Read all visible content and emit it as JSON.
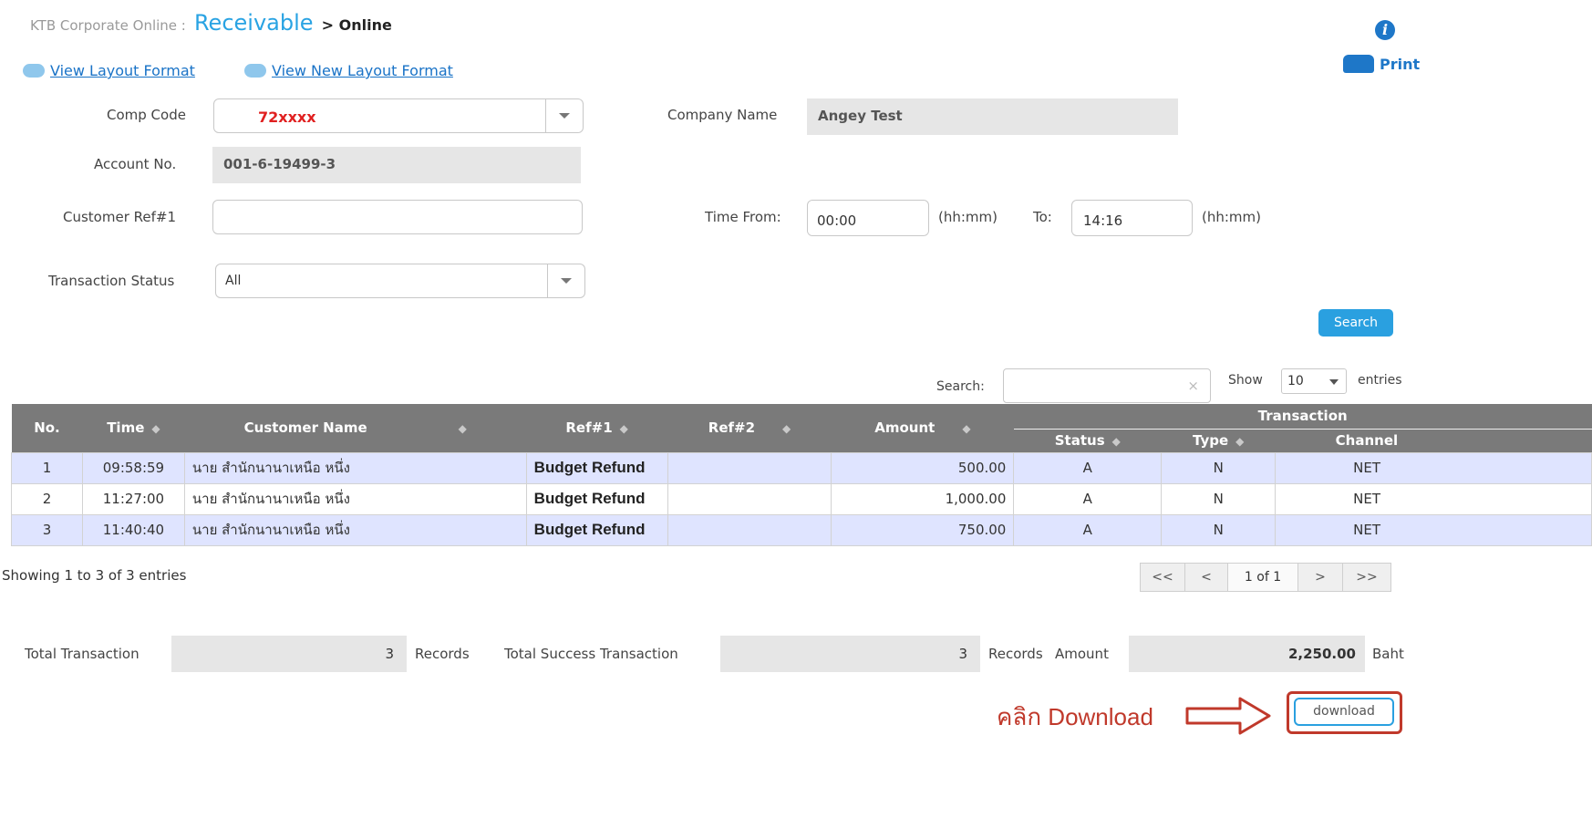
{
  "header": {
    "brand": "KTB Corporate Online :",
    "module": "Receivable",
    "crumb": "> Online"
  },
  "links": {
    "layout": "View Layout Format",
    "new_layout": "View New Layout Format",
    "print": "Print"
  },
  "form": {
    "comp_code_label": "Comp Code",
    "comp_code_value": "72xxxx",
    "company_name_label": "Company Name",
    "company_name_value": "Angey Test",
    "account_label": "Account No.",
    "account_value": "001-6-19499-3",
    "customer_ref_label": "Customer Ref#1",
    "customer_ref_value": "",
    "time_from_label": "Time From:",
    "time_from_value": "00:00",
    "time_format": "(hh:mm)",
    "to_label": "To:",
    "time_to_value": "14:16",
    "status_label": "Transaction Status",
    "status_value": "All",
    "search_button": "Search"
  },
  "table_controls": {
    "search_label": "Search:",
    "search_clear": "×",
    "show_label": "Show",
    "show_value": "10",
    "entries_label": "entries"
  },
  "table": {
    "headers": {
      "no": "No.",
      "time": "Time",
      "customer_name": "Customer Name",
      "ref1": "Ref#1",
      "ref2": "Ref#2",
      "amount": "Amount",
      "transaction": "Transaction",
      "status": "Status",
      "type": "Type",
      "channel": "Channel"
    },
    "rows": [
      {
        "no": "1",
        "time": "09:58:59",
        "name": "นาย สำนักนานาเหนือ หนึ่ง",
        "ref1": "Budget Refund",
        "ref2": "",
        "amount": "500.00",
        "status": "A",
        "type": "N",
        "channel": "NET"
      },
      {
        "no": "2",
        "time": "11:27:00",
        "name": "นาย สำนักนานาเหนือ หนึ่ง",
        "ref1": "Budget Refund",
        "ref2": "",
        "amount": "1,000.00",
        "status": "A",
        "type": "N",
        "channel": "NET"
      },
      {
        "no": "3",
        "time": "11:40:40",
        "name": "นาย สำนักนานาเหนือ หนึ่ง",
        "ref1": "Budget Refund",
        "ref2": "",
        "amount": "750.00",
        "status": "A",
        "type": "N",
        "channel": "NET"
      }
    ]
  },
  "pagination": {
    "info": "Showing 1 to 3 of 3 entries",
    "first": "<<",
    "prev": "<",
    "current": "1 of 1",
    "next": ">",
    "last": ">>"
  },
  "totals": {
    "total_label": "Total Transaction",
    "total_value": "3",
    "records": "Records",
    "success_label": "Total Success Transaction",
    "success_value": "3",
    "amount_label": "Amount",
    "amount_value": "2,250.00",
    "currency": "Baht"
  },
  "annotation": {
    "text": "คลิก Download",
    "download_button": "download"
  },
  "colors": {
    "accent": "#2aa0e0",
    "header_bg": "#7a7a7a",
    "row_alt": "#dfe4ff",
    "annotation": "#c0392b"
  }
}
